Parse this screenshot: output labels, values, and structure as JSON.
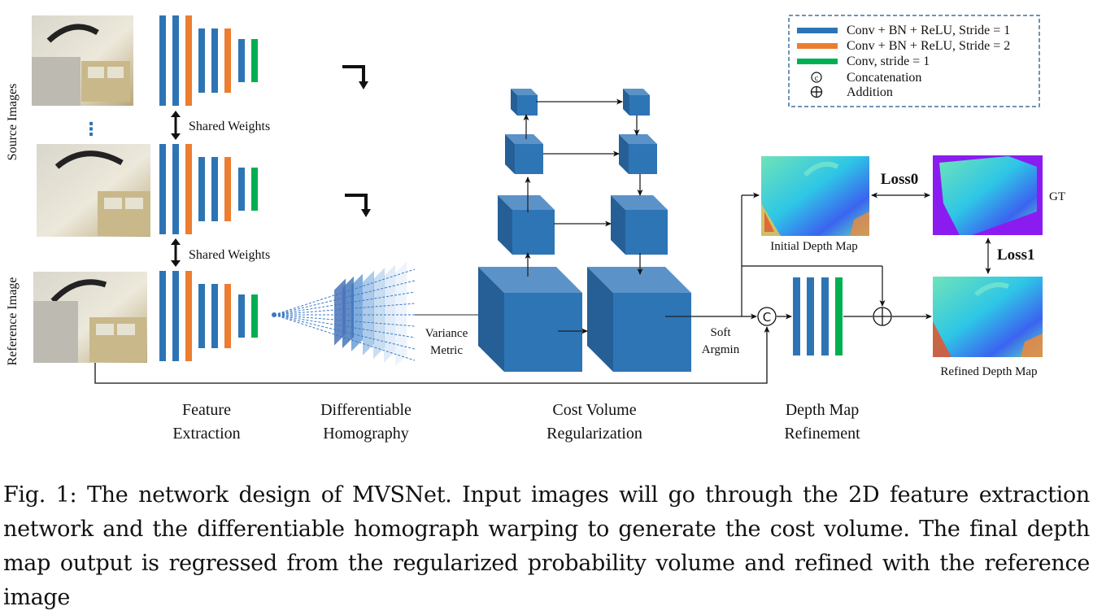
{
  "colors": {
    "conv_bn_relu_s1": "#2e74b5",
    "conv_bn_relu_s2": "#ed7d31",
    "conv_s1": "#00b050",
    "cube_front": "#2e75b6",
    "cube_top": "#5b93c8",
    "cube_side": "#255f96",
    "legend_border": "#41719c"
  },
  "legend": {
    "items": [
      {
        "symbol": "blue-bar",
        "label": "Conv + BN + ReLU, Stride = 1"
      },
      {
        "symbol": "orange-bar",
        "label": "Conv + BN + ReLU, Stride = 2"
      },
      {
        "symbol": "green-bar",
        "label": "Conv, stride = 1"
      },
      {
        "symbol": "concat",
        "glyph": "c",
        "label": "Concatenation"
      },
      {
        "symbol": "add",
        "glyph": "+",
        "label": "Addition"
      }
    ]
  },
  "labels": {
    "source_images": "Source Images",
    "reference_image": "Reference Image",
    "shared_weights_1": "Shared Weights",
    "shared_weights_2": "Shared Weights",
    "ellipsis": "⋮",
    "variance_1": "Variance",
    "variance_2": "Metric",
    "soft_1": "Soft",
    "soft_2": "Argmin",
    "initial_depth": "Initial Depth Map",
    "refined_depth": "Refined Depth Map",
    "gt": "GT",
    "loss0": "Loss0",
    "loss1": "Loss1",
    "concat_glyph": "C"
  },
  "stages": [
    {
      "line1": "Feature",
      "line2": "Extraction"
    },
    {
      "line1": "Differentiable",
      "line2": "Homography"
    },
    {
      "line1": "Cost Volume",
      "line2": "Regularization"
    },
    {
      "line1": "Depth Map",
      "line2": "Refinement"
    }
  ],
  "feature_extractor_layers": [
    "s1",
    "s1",
    "s2",
    "s1",
    "s1",
    "s2",
    "s1",
    "conv"
  ],
  "refinement_layers": [
    "s1",
    "s1",
    "s1",
    "conv"
  ],
  "caption": "Fig. 1: The network design of MVSNet. Input images will go through the 2D feature extraction network and the differentiable homograph warping to generate the cost volume. The final depth map output is regressed from the regularized probability volume and refined with the reference image"
}
